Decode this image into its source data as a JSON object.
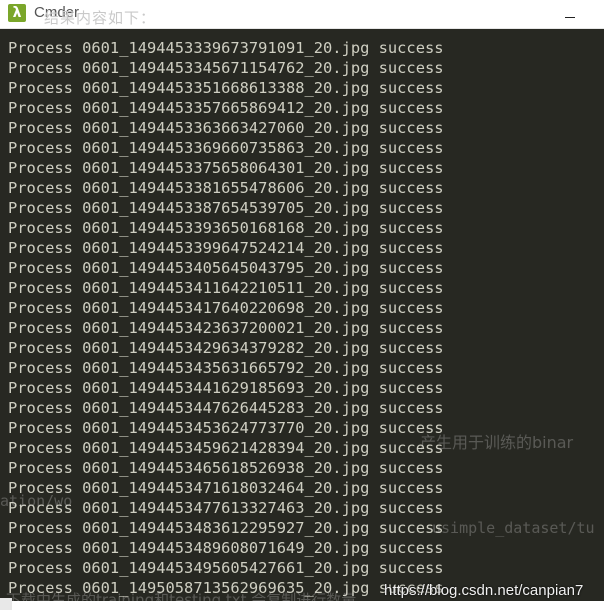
{
  "window": {
    "title": "Cmder",
    "app_icon": "λ",
    "background_heading": "结果内容如下："
  },
  "terminal": {
    "lines": [
      "Process 0601_1494453339673791091_20.jpg success",
      "Process 0601_1494453345671154762_20.jpg success",
      "Process 0601_1494453351668613388_20.jpg success",
      "Process 0601_1494453357665869412_20.jpg success",
      "Process 0601_1494453363663427060_20.jpg success",
      "Process 0601_1494453369660735863_20.jpg success",
      "Process 0601_1494453375658064301_20.jpg success",
      "Process 0601_1494453381655478606_20.jpg success",
      "Process 0601_1494453387654539705_20.jpg success",
      "Process 0601_1494453393650168168_20.jpg success",
      "Process 0601_1494453399647524214_20.jpg success",
      "Process 0601_1494453405645043795_20.jpg success",
      "Process 0601_1494453411642210511_20.jpg success",
      "Process 0601_1494453417640220698_20.jpg success",
      "Process 0601_1494453423637200021_20.jpg success",
      "Process 0601_1494453429634379282_20.jpg success",
      "Process 0601_1494453435631665792_20.jpg success",
      "Process 0601_1494453441629185693_20.jpg success",
      "Process 0601_1494453447626445283_20.jpg success",
      "Process 0601_1494453453624773770_20.jpg success",
      "Process 0601_1494453459621428394_20.jpg success",
      "Process 0601_1494453465618526938_20.jpg success",
      "Process 0601_1494453471618032464_20.jpg success",
      "Process 0601_1494453477613327463_20.jpg success",
      "Process 0601_1494453483612295927_20.jpg success",
      "Process 0601_1494453489608071649_20.jpg success",
      "Process 0601_1494453495605427661_20.jpg success",
      "Process 0601_1495058713562969635_20.jpg success"
    ]
  },
  "background_text": {
    "right_fragment": "产生用于训练的binar",
    "left_fragment": "ation/wo",
    "path_fragment": "usimple_dataset/tu",
    "bottom_fragment": "下载中生成的training和testing.txt 会复制进行数量"
  },
  "watermark": "https://blog.csdn.net/canpian7"
}
